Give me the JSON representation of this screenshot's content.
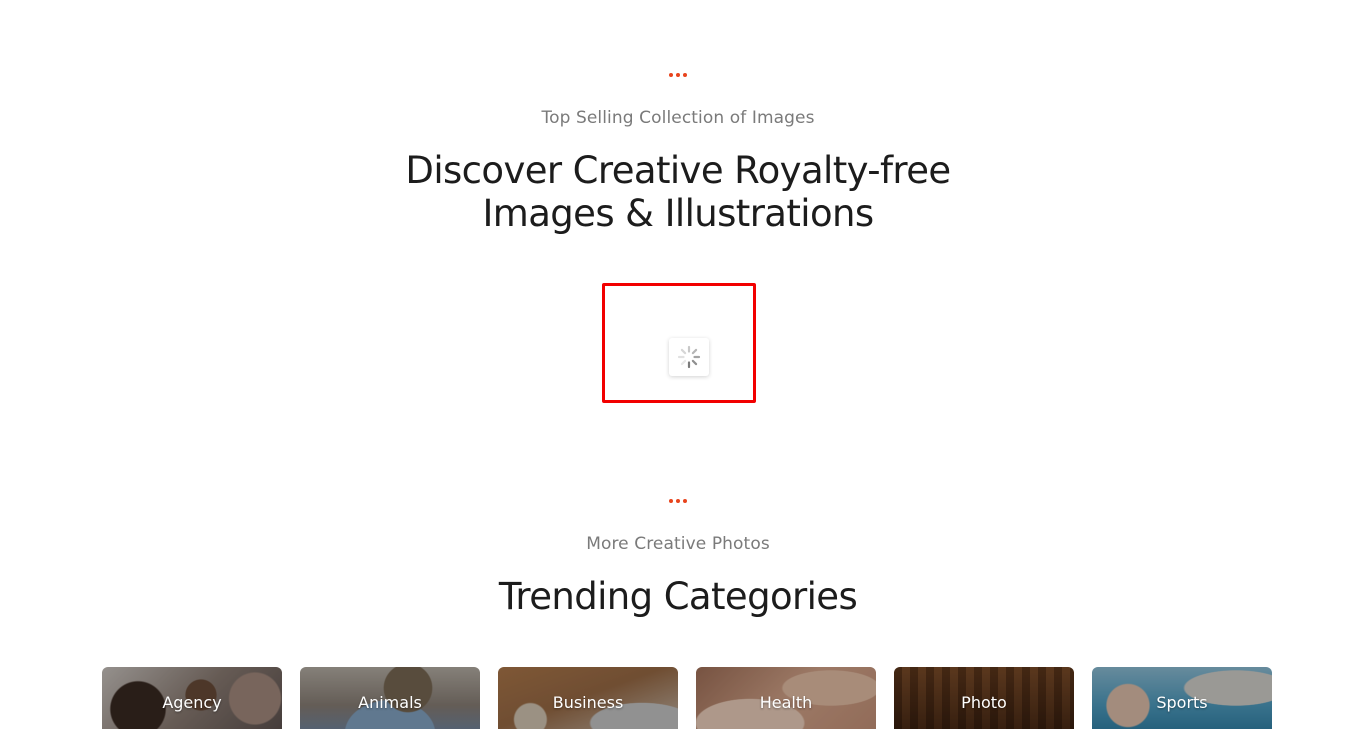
{
  "colors": {
    "accent": "#e8441d",
    "highlight_border": "#f20000"
  },
  "featured": {
    "eyebrow": "Top Selling Collection of Images",
    "title_line1": "Discover Creative Royalty-free",
    "title_line2": "Images & Illustrations",
    "loader_icon": "spinner-icon"
  },
  "trending": {
    "eyebrow": "More Creative Photos",
    "title": "Trending Categories",
    "categories": [
      {
        "label": "Agency"
      },
      {
        "label": "Animals"
      },
      {
        "label": "Business"
      },
      {
        "label": "Health"
      },
      {
        "label": "Photo"
      },
      {
        "label": "Sports"
      }
    ]
  }
}
